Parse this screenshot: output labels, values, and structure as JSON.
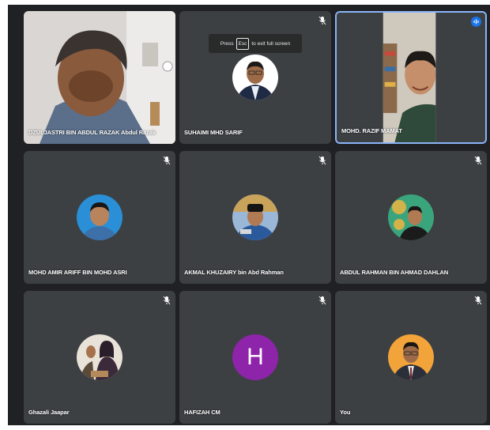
{
  "meeting": {
    "fullscreen_hint": {
      "prefix": "Press",
      "key": "Esc",
      "suffix": "to exit full screen"
    },
    "participants": [
      {
        "name": "DZULJASTRI BIN ABDUL RAZAK Abdul Razak",
        "type": "video",
        "muted": false
      },
      {
        "name": "SUHAIMI MHD SARIF",
        "type": "photo",
        "muted": true
      },
      {
        "name": "MOHD. RAZIF MAMAT",
        "type": "video",
        "muted": false,
        "speaking": true
      },
      {
        "name": "MOHD AMIR ARIFF BIN MOHD ASRI",
        "type": "photo",
        "muted": true
      },
      {
        "name": "AKMAL KHUZAIRY bin Abd Rahman",
        "type": "photo",
        "muted": true
      },
      {
        "name": "ABDUL RAHMAN BIN AHMAD DAHLAN",
        "type": "photo",
        "muted": true
      },
      {
        "name": "Ghazali Jaapar",
        "type": "photo",
        "muted": true
      },
      {
        "name": "HAFIZAH CM",
        "type": "letter",
        "initial": "H",
        "avatar_color": "#8e24aa",
        "muted": true
      },
      {
        "name": "You",
        "type": "photo",
        "muted": true
      }
    ]
  },
  "colors": {
    "tile": "#3c4043",
    "stage": "#202124",
    "active_border": "#8ab4f8",
    "speaking": "#1a73e8"
  },
  "icons": {
    "mic_off": "mic-off-icon",
    "speaking": "audio-level-icon"
  }
}
